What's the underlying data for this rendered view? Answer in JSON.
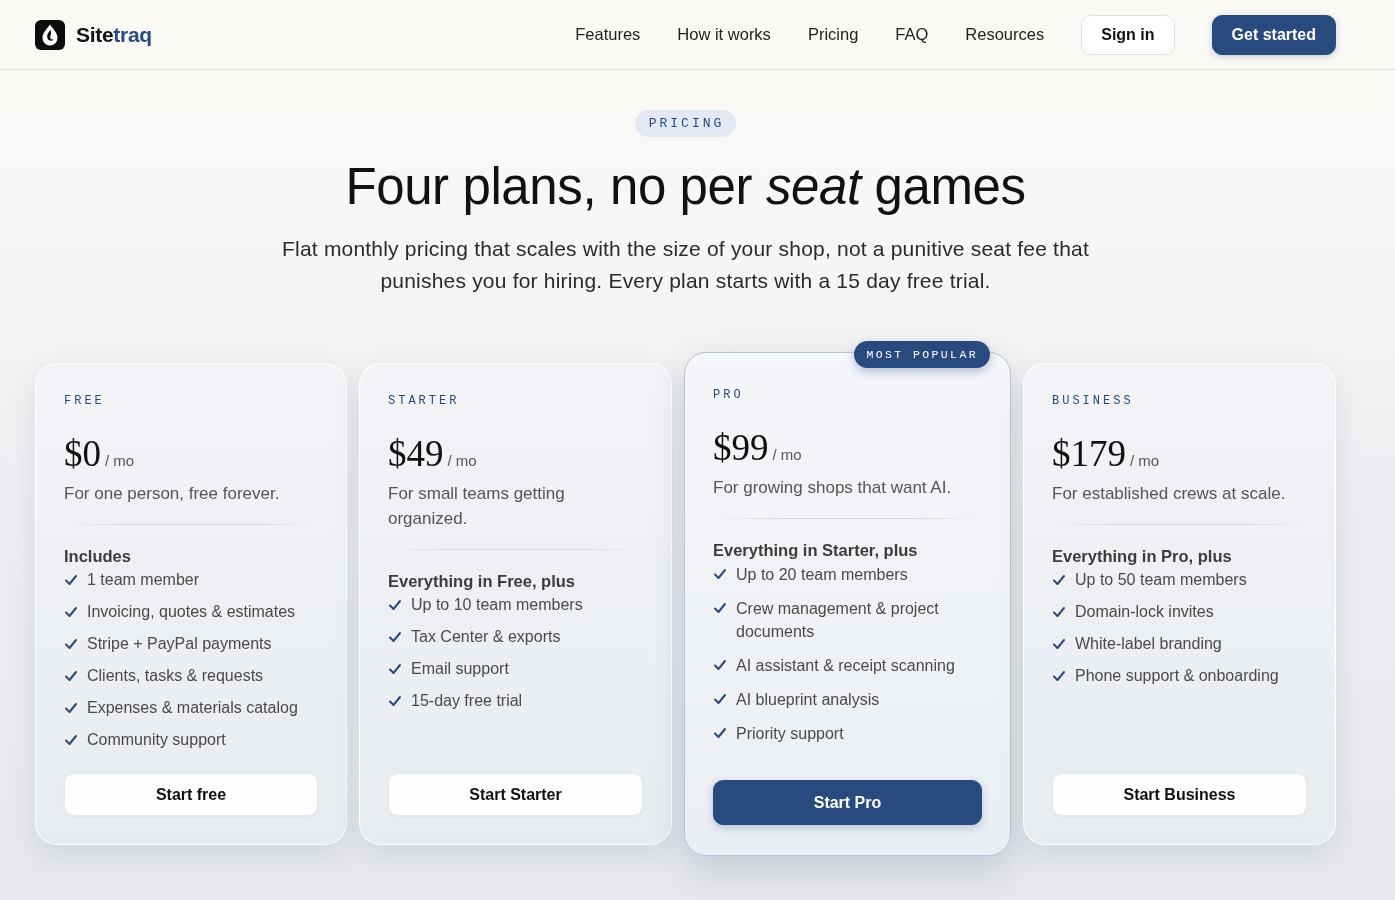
{
  "nav": {
    "brand": {
      "name": "Site",
      "accent": "traq"
    },
    "links": [
      "Features",
      "How it works",
      "Pricing",
      "FAQ",
      "Resources"
    ],
    "sign_in": "Sign in",
    "cta": "Get started"
  },
  "hero": {
    "eyebrow": "PRICING",
    "title": "Four plans, no per *seat* games",
    "subtitle": "Flat monthly pricing that scales with the size of your shop, not a punitive seat fee that punishes you for hiring. Every plan starts with a 15 day free trial."
  },
  "plans": [
    {
      "tier": "FREE",
      "price": "$0",
      "period": "/ mo",
      "description": "For one person, free forever.",
      "features_heading": "Includes",
      "features": [
        "1 team member",
        "Invoicing, quotes & estimates",
        "Stripe + PayPal payments",
        "Clients, tasks & requests",
        "Expenses & materials catalog",
        "Community support"
      ],
      "button": "Start free",
      "featured": false
    },
    {
      "tier": "STARTER",
      "price": "$49",
      "period": "/ mo",
      "description": "For small teams getting organized.",
      "features_heading": "Everything in Free, plus",
      "features": [
        "Up to 10 team members",
        "Tax Center & exports",
        "Email support",
        "15-day free trial"
      ],
      "button": "Start Starter",
      "featured": false
    },
    {
      "tier": "PRO",
      "badge": "MOST POPULAR",
      "price": "$99",
      "period": "/ mo",
      "description": "For growing shops that want AI.",
      "features_heading": "Everything in Starter, plus",
      "features": [
        "Up to 20 team members",
        "Crew management & project documents",
        "AI assistant & receipt scanning",
        "AI blueprint analysis",
        "Priority support"
      ],
      "button": "Start Pro",
      "featured": true
    },
    {
      "tier": "BUSINESS",
      "price": "$179",
      "period": "/ mo",
      "description": "For established crews at scale.",
      "features_heading": "Everything in Pro, plus",
      "features": [
        "Up to 50 team members",
        "Domain-lock invites",
        "White-label branding",
        "Phone support & onboarding"
      ],
      "button": "Start Business",
      "featured": false
    }
  ]
}
